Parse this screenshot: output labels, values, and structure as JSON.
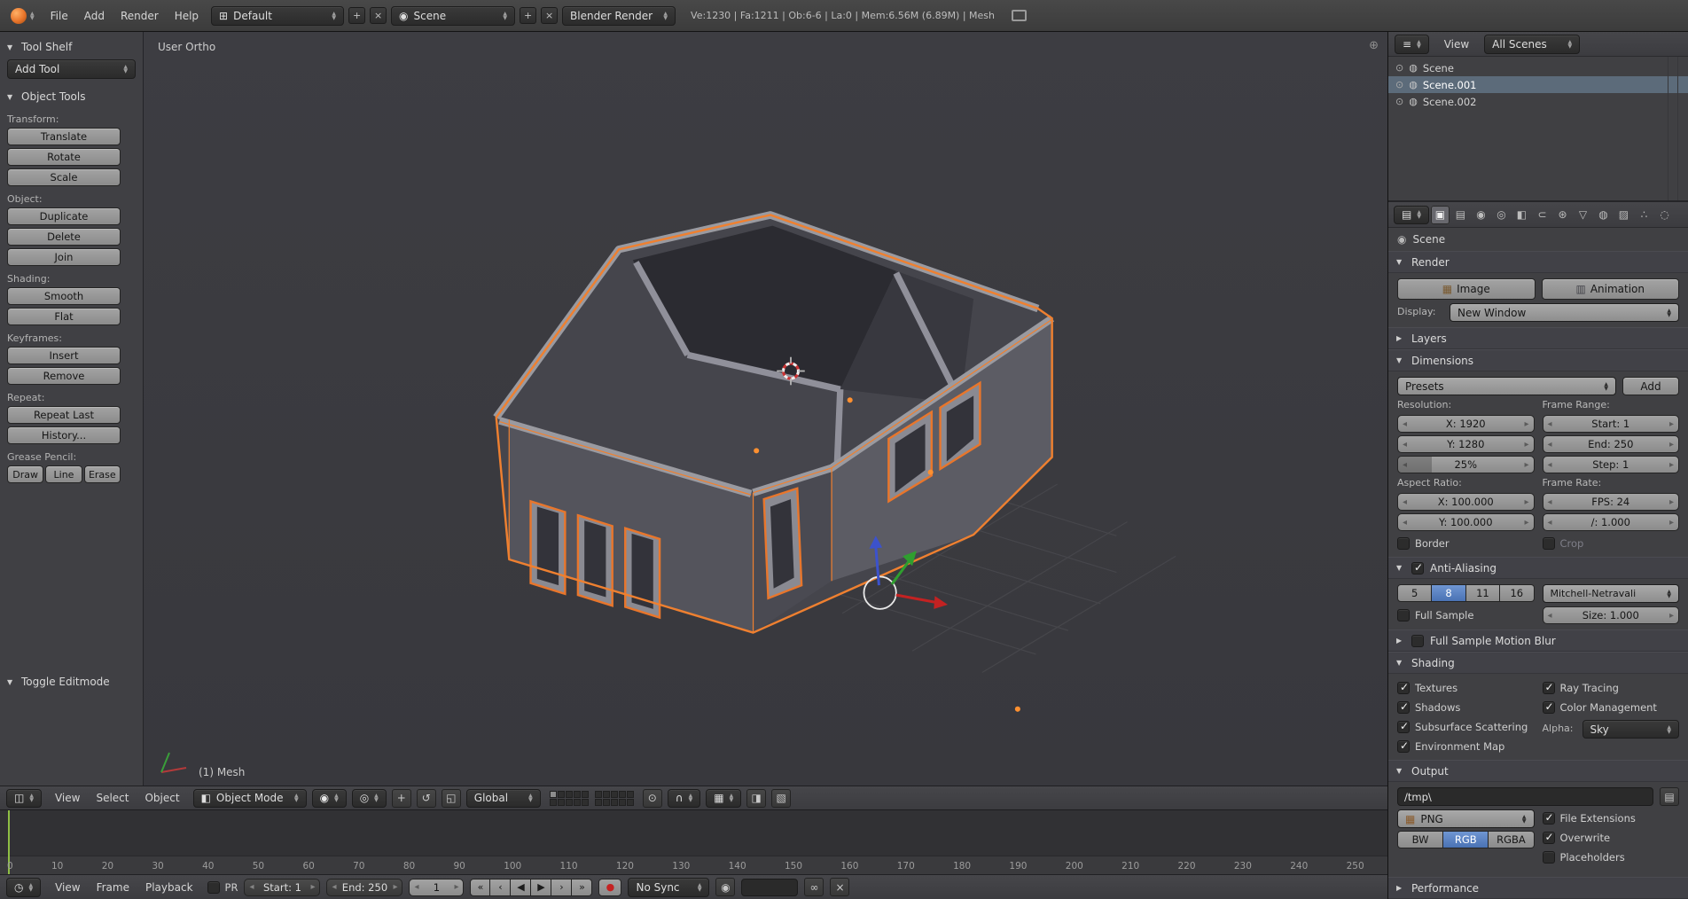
{
  "icons": {
    "screen_grid": "⊞",
    "list": "≡",
    "props_editor": "▤",
    "clock": "◷",
    "editor_3d": "◫",
    "sphere": "◉",
    "pivot": "◎",
    "cube": "◧",
    "translate": "+",
    "rotate": "↺",
    "scale": "◱",
    "magnet": "∩",
    "lock": "⊙",
    "snap_box": "▦",
    "render_left": "◨",
    "render_right": "▧",
    "image": "▦",
    "clapper": "▥",
    "folder": "▤",
    "record": "●",
    "speaker": "◉",
    "link": "∞",
    "cut": "×",
    "plus": "+",
    "close": "×",
    "corner": "⊕",
    "scene_dot": "◍",
    "visibility": "⊙",
    "crumb_scene": "◉"
  },
  "colors": {
    "accent_orange": "#ef8030",
    "selected_blue": "#4a72b4",
    "frame_green": "#8fbf45"
  },
  "top_header": {
    "menus": [
      {
        "label": "File"
      },
      {
        "label": "Add"
      },
      {
        "label": "Render"
      },
      {
        "label": "Help"
      }
    ],
    "layout_value": "Default",
    "scene_value": "Scene",
    "engine_value": "Blender Render",
    "stats": "Ve:1230 | Fa:1211 | Ob:6-6 | La:0 | Mem:6.56M (6.89M) | Mesh"
  },
  "tool_shelf": {
    "title": "Tool Shelf",
    "add_tool": "Add Tool",
    "object_tools_title": "Object Tools",
    "sections": {
      "transform": {
        "label": "Transform:",
        "buttons": [
          {
            "label": "Translate"
          },
          {
            "label": "Rotate"
          },
          {
            "label": "Scale"
          }
        ]
      },
      "object": {
        "label": "Object:",
        "buttons": [
          {
            "label": "Duplicate"
          },
          {
            "label": "Delete"
          },
          {
            "label": "Join"
          }
        ]
      },
      "shading": {
        "label": "Shading:",
        "buttons": [
          {
            "label": "Smooth"
          },
          {
            "label": "Flat"
          }
        ]
      },
      "keyframes": {
        "label": "Keyframes:",
        "buttons": [
          {
            "label": "Insert"
          },
          {
            "label": "Remove"
          }
        ]
      },
      "repeat": {
        "label": "Repeat:",
        "buttons": [
          {
            "label": "Repeat Last"
          },
          {
            "label": "History..."
          }
        ]
      },
      "grease": {
        "label": "Grease Pencil:",
        "buttons": [
          {
            "label": "Draw"
          },
          {
            "label": "Line"
          },
          {
            "label": "Erase"
          }
        ]
      }
    },
    "toggle_editmode": "Toggle Editmode"
  },
  "viewport": {
    "view_label": "User Ortho",
    "object_label": "(1) Mesh"
  },
  "viewport_header": {
    "menus": [
      {
        "label": "View"
      },
      {
        "label": "Select"
      },
      {
        "label": "Object"
      }
    ],
    "mode_value": "Object Mode",
    "global_value": "Global"
  },
  "timeline": {
    "frame_numbers": [
      "0",
      "10",
      "20",
      "30",
      "40",
      "50",
      "60",
      "70",
      "80",
      "90",
      "100",
      "110",
      "120",
      "130",
      "140",
      "150",
      "160",
      "170",
      "180",
      "190",
      "200",
      "210",
      "220",
      "230",
      "240",
      "250"
    ],
    "menus": [
      {
        "label": "View"
      },
      {
        "label": "Frame"
      },
      {
        "label": "Playback"
      }
    ],
    "pr_label": "PR",
    "start_value": "Start: 1",
    "end_value": "End: 250",
    "current_frame": "1",
    "playback": [
      {
        "glyph": "«",
        "name": "jump-to-start"
      },
      {
        "glyph": "‹",
        "name": "jump-to-prev-keyframe"
      },
      {
        "glyph": "◀",
        "name": "play-reverse"
      },
      {
        "glyph": "▶",
        "name": "play"
      },
      {
        "glyph": "›",
        "name": "jump-to-next-keyframe"
      },
      {
        "glyph": "»",
        "name": "jump-to-end"
      }
    ],
    "sync_value": "No Sync"
  },
  "outliner": {
    "view_label": "View",
    "scenes_value": "All Scenes",
    "items": [
      {
        "label": "Scene"
      },
      {
        "label": "Scene.001",
        "selected": true
      },
      {
        "label": "Scene.002"
      }
    ]
  },
  "properties": {
    "tabs": [
      {
        "glyph": "▣",
        "selected": true
      },
      {
        "glyph": "▤"
      },
      {
        "glyph": "◉"
      },
      {
        "glyph": "◎"
      },
      {
        "glyph": "◧"
      },
      {
        "glyph": "⊂"
      },
      {
        "glyph": "⊛"
      },
      {
        "glyph": "▽"
      },
      {
        "glyph": "◍"
      },
      {
        "glyph": "▨"
      },
      {
        "glyph": "∴"
      },
      {
        "glyph": "◌"
      }
    ],
    "breadcrumb": "Scene",
    "render": {
      "title": "Render",
      "image_label": "Image",
      "animation_label": "Animation",
      "display_label": "Display:",
      "display_value": "New Window"
    },
    "layers_title": "Layers",
    "dimensions": {
      "title": "Dimensions",
      "presets_label": "Presets",
      "add_label": "Add",
      "resolution_label": "Resolution:",
      "res_x": "X: 1920",
      "res_y": "Y: 1280",
      "res_pct": "25%",
      "frame_range_label": "Frame Range:",
      "start": "Start: 1",
      "end": "End: 250",
      "step": "Step: 1",
      "aspect_label": "Aspect Ratio:",
      "aspect_x": "X: 100.000",
      "aspect_y": "Y: 100.000",
      "framerate_label": "Frame Rate:",
      "fps": "FPS: 24",
      "fps_base": "/: 1.000",
      "toggles": [
        {
          "label": "Border"
        },
        {
          "label": "Crop",
          "dim": true
        }
      ]
    },
    "antialiasing": {
      "title": "Anti-Aliasing",
      "samples": [
        {
          "label": "5"
        },
        {
          "label": "8",
          "selected": true
        },
        {
          "label": "11"
        },
        {
          "label": "16"
        }
      ],
      "filter_value": "Mitchell-Netravali",
      "full_sample_label": "Full Sample",
      "size_value": "Size: 1.000"
    },
    "motion_blur_title": "Full Sample Motion Blur",
    "shading": {
      "title": "Shading",
      "left": [
        {
          "label": "Textures",
          "checked": true
        },
        {
          "label": "Shadows",
          "checked": true
        },
        {
          "label": "Subsurface Scattering",
          "checked": true
        },
        {
          "label": "Environment Map",
          "checked": true
        }
      ],
      "right": [
        {
          "label": "Ray Tracing",
          "checked": true
        },
        {
          "label": "Color Management",
          "checked": true
        }
      ],
      "alpha_label": "Alpha:",
      "alpha_value": "Sky"
    },
    "output": {
      "title": "Output",
      "path": "/tmp\\",
      "format_value": "PNG",
      "modes": [
        {
          "label": "BW"
        },
        {
          "label": "RGB",
          "selected": true
        },
        {
          "label": "RGBA"
        }
      ],
      "checks": [
        {
          "label": "File Extensions",
          "checked": true
        },
        {
          "label": "Overwrite",
          "checked": true
        },
        {
          "label": "Placeholders",
          "checked": false
        }
      ]
    },
    "performance_title": "Performance"
  }
}
